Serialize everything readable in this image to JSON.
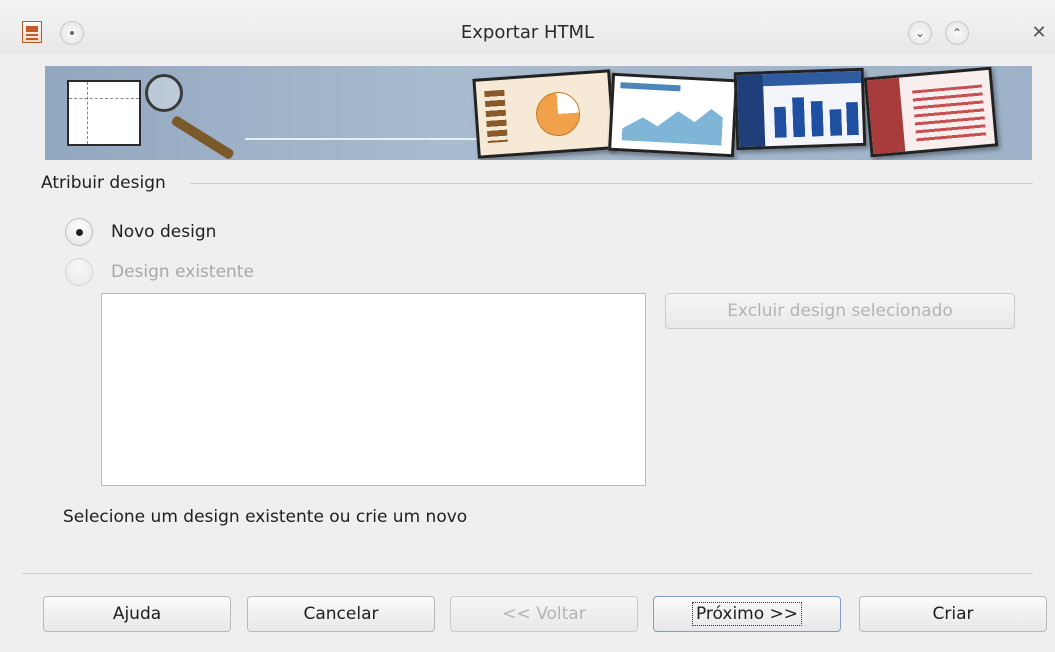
{
  "window": {
    "title": "Exportar HTML"
  },
  "section": {
    "title": "Atribuir design"
  },
  "options": {
    "new_design_label": "Novo design",
    "existing_design_label": "Design existente",
    "selected": "new_design"
  },
  "design_list": {
    "items": []
  },
  "delete_button_label": "Excluir design selecionado",
  "hint_text": "Selecione um design existente ou crie um novo",
  "footer": {
    "help_label": "Ajuda",
    "cancel_label": "Cancelar",
    "back_label": "<< Voltar",
    "next_label": "Próximo >>",
    "create_label": "Criar"
  },
  "icons": {
    "app": "impress-document-icon",
    "menu": "window-menu-icon",
    "minimize": "chevron-down-icon",
    "maximize": "chevron-up-icon",
    "close": "close-icon"
  }
}
